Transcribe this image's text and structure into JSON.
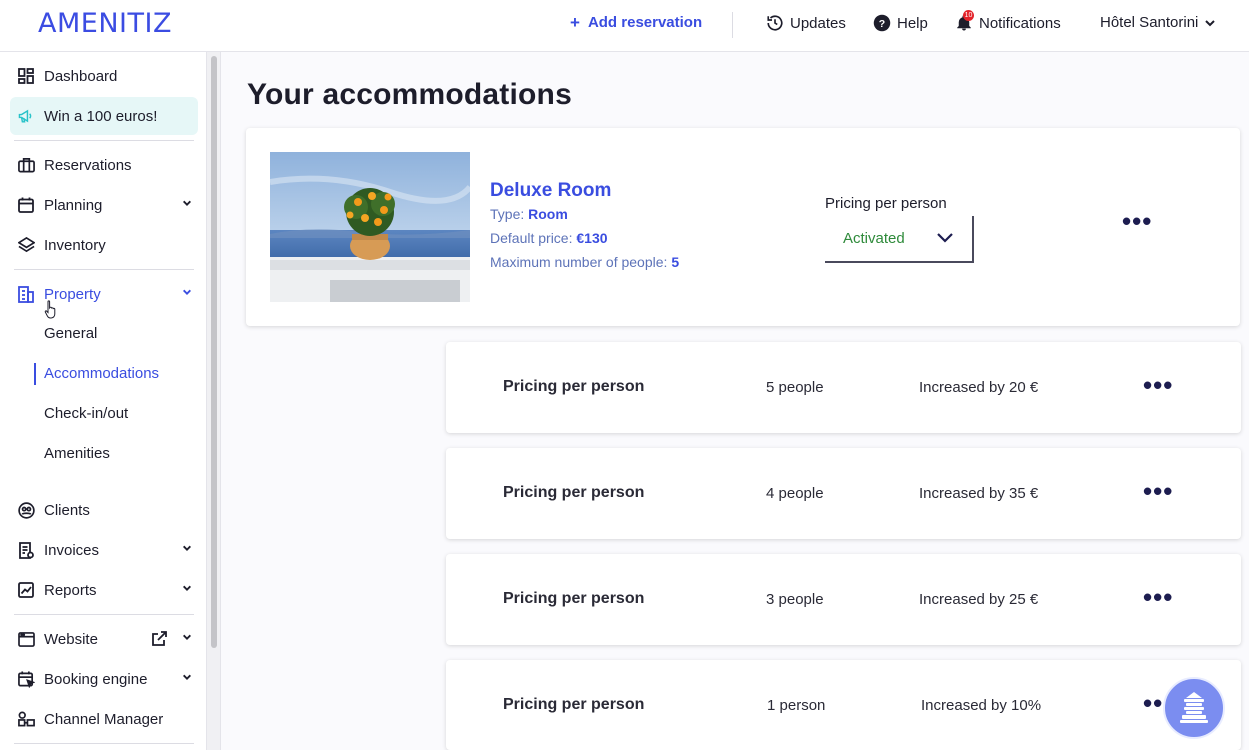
{
  "brand": {
    "logo": "AMENITIZ"
  },
  "topbar": {
    "add_reservation": "Add reservation",
    "updates": "Updates",
    "help": "Help",
    "notifications": "Notifications",
    "notification_count": "10",
    "hotel": "Hôtel Santorini"
  },
  "sidebar": {
    "dashboard": "Dashboard",
    "promo": "Win a 100 euros!",
    "reservations": "Reservations",
    "planning": "Planning",
    "inventory": "Inventory",
    "property": "Property",
    "property_sub": {
      "general": "General",
      "accommodations": "Accommodations",
      "checkin": "Check-in/out",
      "amenities": "Amenities"
    },
    "clients": "Clients",
    "invoices": "Invoices",
    "reports": "Reports",
    "website": "Website",
    "booking_engine": "Booking engine",
    "channel_manager": "Channel Manager"
  },
  "main": {
    "title": "Your accommodations",
    "room": {
      "name": "Deluxe Room",
      "type_label": "Type:",
      "type_value": "Room",
      "price_label": "Default price:",
      "price_value": "€130",
      "max_label": "Maximum number of people:",
      "max_value": "5",
      "pricing_label": "Pricing per person",
      "pricing_value": "Activated"
    },
    "pricing_rows": [
      {
        "title": "Pricing per person",
        "people": "5 people",
        "increase": "Increased by 20 €"
      },
      {
        "title": "Pricing per person",
        "people": "4 people",
        "increase": "Increased by 35 €"
      },
      {
        "title": "Pricing per person",
        "people": "3 people",
        "increase": "Increased by 25 €"
      },
      {
        "title": "Pricing per person",
        "people": "1 person",
        "increase": "Increased by 10%"
      }
    ]
  },
  "colors": {
    "accent": "#3a4de0",
    "activated": "#2e8a3a",
    "promo_bg": "#e6f7f7",
    "notif_badge": "#e3242b"
  },
  "icons": {
    "more": "more-dots-icon",
    "help_widget": "help-widget-icon"
  }
}
